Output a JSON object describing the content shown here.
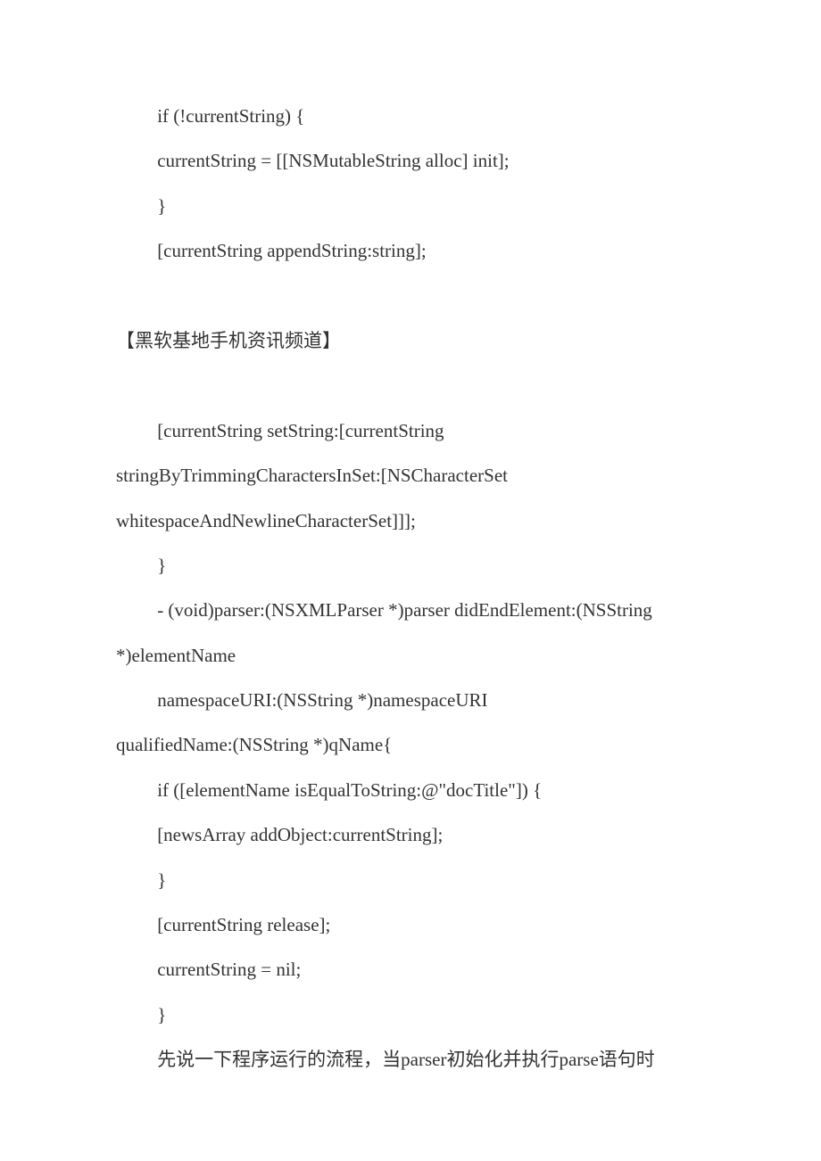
{
  "lines": [
    {
      "text": "if (!currentString) {",
      "indent": "indent-2"
    },
    {
      "text": "currentString = [[NSMutableString alloc] init];",
      "indent": "indent-2"
    },
    {
      "text": "}",
      "indent": "indent-2"
    },
    {
      "text": "[currentString appendString:string];",
      "indent": "indent-2"
    },
    {
      "text": "",
      "indent": "blank"
    },
    {
      "text": "【黑软基地手机资讯频道】",
      "indent": "indent-0"
    },
    {
      "text": "",
      "indent": "blank"
    },
    {
      "text": "[currentString setString:[currentString",
      "indent": "indent-2"
    },
    {
      "text": "stringByTrimmingCharactersInSet:[NSCharacterSet",
      "indent": "indent-0"
    },
    {
      "text": "whitespaceAndNewlineCharacterSet]]];",
      "indent": "indent-0"
    },
    {
      "text": "}",
      "indent": "indent-2"
    },
    {
      "text": "- (void)parser:(NSXMLParser *)parser didEndElement:(NSString",
      "indent": "indent-2"
    },
    {
      "text": "*)elementName",
      "indent": "indent-0"
    },
    {
      "text": "namespaceURI:(NSString *)namespaceURI",
      "indent": "indent-2"
    },
    {
      "text": "qualifiedName:(NSString *)qName{",
      "indent": "indent-0"
    },
    {
      "text": "if ([elementName isEqualToString:@\"docTitle\"]) {",
      "indent": "indent-2"
    },
    {
      "text": "[newsArray addObject:currentString];",
      "indent": "indent-2"
    },
    {
      "text": "}",
      "indent": "indent-2"
    },
    {
      "text": "[currentString release];",
      "indent": "indent-2"
    },
    {
      "text": "currentString = nil;",
      "indent": "indent-2"
    },
    {
      "text": "}",
      "indent": "indent-2"
    },
    {
      "text": "先说一下程序运行的流程，当parser初始化并执行parse语句时",
      "indent": "indent-2"
    }
  ]
}
